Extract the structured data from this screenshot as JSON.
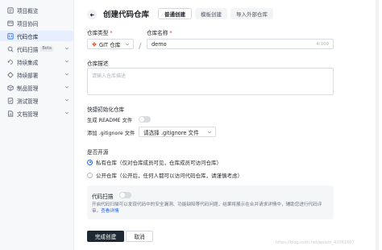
{
  "sidebar": {
    "items": [
      {
        "label": "项目概览",
        "icon": "overview-icon",
        "active": false
      },
      {
        "label": "项目协同",
        "icon": "collab-icon",
        "active": false
      },
      {
        "label": "代码仓库",
        "icon": "code-icon",
        "active": true
      },
      {
        "label": "代码扫描",
        "badge": "Beta",
        "icon": "scan-icon",
        "active": false
      },
      {
        "label": "持续集成",
        "icon": "ci-icon",
        "active": false
      },
      {
        "label": "持续部署",
        "icon": "deploy-icon",
        "active": false
      },
      {
        "label": "制品管理",
        "icon": "artifact-icon",
        "active": false
      },
      {
        "label": "测试管理",
        "icon": "test-icon",
        "active": false
      },
      {
        "label": "文档管理",
        "icon": "doc-icon",
        "active": false
      }
    ]
  },
  "header": {
    "title": "创建代码仓库",
    "tabs": [
      {
        "label": "普通创建",
        "active": true
      },
      {
        "label": "模板创建",
        "active": false
      },
      {
        "label": "导入外部仓库",
        "active": false
      }
    ]
  },
  "form": {
    "repo_type_label": "仓库类型",
    "repo_type_value": "GIT 仓库",
    "repo_name_label": "仓库名称",
    "repo_name_value": "demo",
    "repo_name_count": "4/100",
    "desc_label": "仓库描述",
    "desc_placeholder": "请输入仓库描述",
    "quick_init_label": "快捷初始化仓库",
    "readme_label": "生成 README 文件",
    "gitignore_label": "添加 .gitignore 文件",
    "gitignore_select": "请选择 .gitignore 文件",
    "open_source_label": "是否开源",
    "private_option": "私有仓库（仅对仓库成员可见，仓库成员可访问仓库）",
    "public_option": "公开仓库（公开后，任何人都可以访问代码仓库，请谨慎考虑）",
    "scan_title": "代码扫描",
    "scan_desc": "开启代码扫描可以发现代码中的安全漏洞、功能缺陷等代码问题，结果将展示在合并请求详情中，辅助您进行代码评审。",
    "scan_link": "查看详情"
  },
  "buttons": {
    "submit": "完成创建",
    "cancel": "取消"
  },
  "watermark": "https://blog.csdn.net/weixin_42361607",
  "colors": {
    "accent": "#1f66e6",
    "primary_button": "#1f2933",
    "active_nav": "#e7efff",
    "required": "#e53935"
  }
}
